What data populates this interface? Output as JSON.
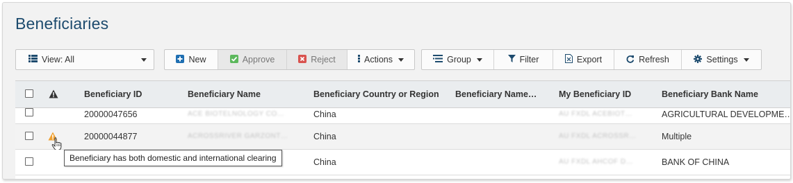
{
  "page": {
    "title": "Beneficiaries"
  },
  "toolbar": {
    "view_label": "View: All",
    "new_label": "New",
    "approve_label": "Approve",
    "reject_label": "Reject",
    "actions_label": "Actions",
    "group_label": "Group",
    "filter_label": "Filter",
    "export_label": "Export",
    "refresh_label": "Refresh",
    "settings_label": "Settings"
  },
  "table": {
    "columns": [
      "Beneficiary ID",
      "Beneficiary Name",
      "Beneficiary Country or Region",
      "Beneficiary Name…",
      "My Beneficiary ID",
      "Beneficiary Bank Name"
    ],
    "rows": [
      {
        "id": "20000047656",
        "name": "ACE BIOTELNOLOGY CO…",
        "country": "China",
        "name2": "",
        "my_id": "AU FXDL ACEBIOT…",
        "bank": "AGRICULTURAL DEVELOPME…",
        "warning": false
      },
      {
        "id": "20000044877",
        "name": "ACROSSRIVER GARZONT…",
        "country": "China",
        "name2": "",
        "my_id": "AU FXDL ACROSSR…",
        "bank": "Multiple",
        "warning": true
      },
      {
        "id": "",
        "name": "…",
        "country": "China",
        "name2": "",
        "my_id": "AU FXDL AHCOF D…",
        "bank": "BANK OF CHINA",
        "warning": false
      }
    ]
  },
  "tooltip": {
    "text": "Beneficiary has both domestic and international clearing"
  },
  "colors": {
    "title": "#1d4b6e",
    "new_icon": "#1f6fb2",
    "approve_icon": "#5cb85c",
    "reject_icon": "#d9534f",
    "warning": "#f0a030"
  }
}
